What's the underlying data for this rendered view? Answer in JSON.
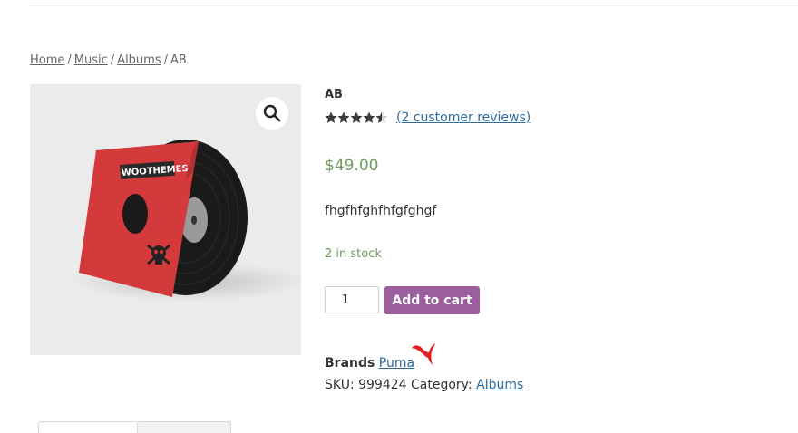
{
  "breadcrumb": {
    "items": [
      "Home",
      "Music",
      "Albums"
    ],
    "separator": "/",
    "current": "AB"
  },
  "gallery": {
    "zoom_icon": "magnifier-icon",
    "sleeve_brand": "WOOTHEMES",
    "sleeve_color": "#d43a3b",
    "vinyl_color": "#1a1a1a"
  },
  "product": {
    "title": "AB",
    "rating": 4.5,
    "reviews_link": "(2 customer reviews)",
    "price": "$49.00",
    "description": "fhgfhfghfhfgfghgf",
    "stock": "2 in stock",
    "quantity": "1",
    "add_to_cart_label": "Add to cart",
    "brands_label": "Brands",
    "brand_name": "Puma",
    "sku_label": "SKU:",
    "sku": "999424",
    "category_label": "Category:",
    "category": "Albums"
  },
  "colors": {
    "accent_button": "#9b5fa0",
    "price_green": "#6d9e5a",
    "link_blue": "#2c6b9e",
    "puma_red": "#e51c23"
  }
}
